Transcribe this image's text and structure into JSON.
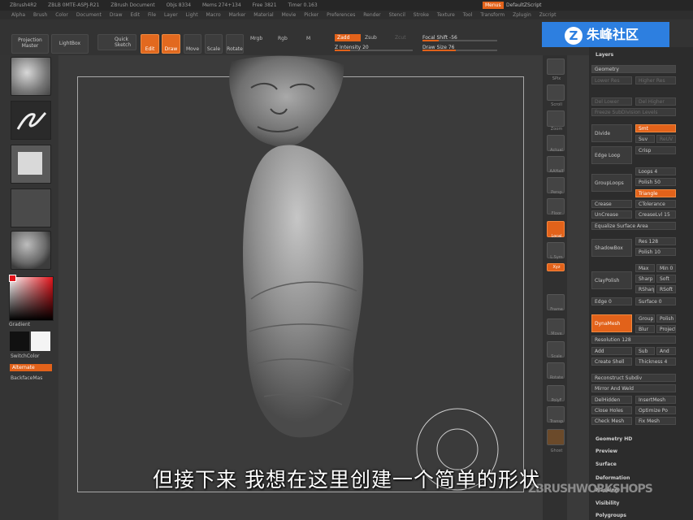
{
  "app": {
    "title_items": [
      "ZBrush4R2",
      "ZBLB 0MTE-ASPJ-R21",
      "ZBrush Document",
      "Objs 8334",
      "Mems 274+134",
      "Free 3821",
      "Timer 0.163"
    ],
    "menu_button": "Menus",
    "script_label": "DefaultZScript",
    "menus": [
      "Alpha",
      "Brush",
      "Color",
      "Document",
      "Draw",
      "Edit",
      "File",
      "Layer",
      "Light",
      "Macro",
      "Marker",
      "Material",
      "Movie",
      "Picker",
      "Preferences",
      "Render",
      "Stencil",
      "Stroke",
      "Texture",
      "Tool",
      "Transform",
      "Zplugin",
      "Zscript"
    ]
  },
  "toolbar": {
    "projection_master": "Projection Master",
    "lightbox": "LightBox",
    "quick_sketch": "Quick Sketch",
    "edit": "Edit",
    "draw": "Draw",
    "move": "Move",
    "scale": "Scale",
    "rotate": "Rotate",
    "mrgb": "Mrgb",
    "rgb": "Rgb",
    "m": "M",
    "zadd": "Zadd",
    "zsub": "Zsub",
    "zcut": "Zcut",
    "z_intensity_label": "Z Intensity",
    "z_intensity": "20",
    "focal_shift_label": "Focal Shift",
    "focal_shift": "-56",
    "draw_size_label": "Draw Size",
    "draw_size": "76"
  },
  "left_shelf": {
    "gradient": "Gradient",
    "switch_color": "SwitchColor",
    "alternate": "Alternate",
    "backface": "BackfaceMas"
  },
  "right_shelf": [
    {
      "name": "spix",
      "label": "SPix"
    },
    {
      "name": "scroll",
      "label": "Scroll"
    },
    {
      "name": "zoom",
      "label": "Zoom"
    },
    {
      "name": "actual",
      "label": "Actual"
    },
    {
      "name": "aahalf",
      "label": "AAHalf"
    },
    {
      "name": "persp",
      "label": "Persp"
    },
    {
      "name": "floor",
      "label": "Floor"
    },
    {
      "name": "local",
      "label": "Local"
    },
    {
      "name": "lsym",
      "label": "L.Sym"
    },
    {
      "name": "xyz",
      "label": "Xyz"
    },
    {
      "name": "frame",
      "label": "Frame"
    },
    {
      "name": "move",
      "label": "Move"
    },
    {
      "name": "scale",
      "label": "Scale"
    },
    {
      "name": "rotate",
      "label": "Rotate"
    },
    {
      "name": "polyf",
      "label": "PolyF"
    },
    {
      "name": "transp",
      "label": "Transp"
    },
    {
      "name": "ghost",
      "label": "Ghost"
    }
  ],
  "panel": {
    "layers": "Layers",
    "geometry": "Geometry",
    "lower_res": "Lower Res",
    "higher_res": "Higher Res",
    "del_lower": "Del Lower",
    "del_higher": "Del Higher",
    "freeze_subdiv": "Freeze SubDivision Levels",
    "divide": "Divide",
    "smt": "Smt",
    "suv": "Suv",
    "rsuv": "ReUV",
    "edge_loop": "Edge Loop",
    "crisp": "Crisp",
    "loops": "Loops 4",
    "grouploops": "GroupLoops",
    "polish": "Polish 50",
    "triangle": "Triangle",
    "crease": "Crease",
    "ctolerance": "CTolerance",
    "uncrease": "UnCrease",
    "creaselvl": "CreaseLvl 15",
    "equalize": "Equalize Surface Area",
    "shadowbox": "ShadowBox",
    "res": "Res 128",
    "polish10": "Polish 10",
    "claypolish": "ClayPolish",
    "max": "Max",
    "min": "Min 0",
    "sharp": "Sharp",
    "soft": "Soft",
    "rsharp": "RSharp",
    "rsoft": "RSoft",
    "edge": "Edge 0",
    "surface": "Surface 0",
    "dynamesh": "DynaMesh",
    "group": "Group",
    "polish2": "Polish",
    "blur": "Blur",
    "project": "Project",
    "resolution": "Resolution 128",
    "add": "Add",
    "sub": "Sub",
    "and": "And",
    "create_shell": "Create Shell",
    "thickness": "Thickness 4",
    "reconstruct": "Reconstruct Subdiv",
    "mirror_weld": "Mirror And Weld",
    "delhidden": "DelHidden",
    "insertmesh": "InsertMesh",
    "close_holes": "Close Holes",
    "optimize": "Optimize Po",
    "check_mesh": "Check Mesh",
    "fix_mesh": "Fix Mesh",
    "geometry_hd": "Geometry HD",
    "preview": "Preview",
    "surface_sec": "Surface",
    "deformation": "Deformation",
    "masking": "Masking",
    "visibility": "Visibility",
    "polygroups": "Polygroups"
  },
  "overlay": {
    "logo_text": "朱峰社区",
    "subtitle": "但接下来   我想在这里创建一个简单的形状",
    "watermark": "ZBRUSHWORKSHOPS"
  }
}
